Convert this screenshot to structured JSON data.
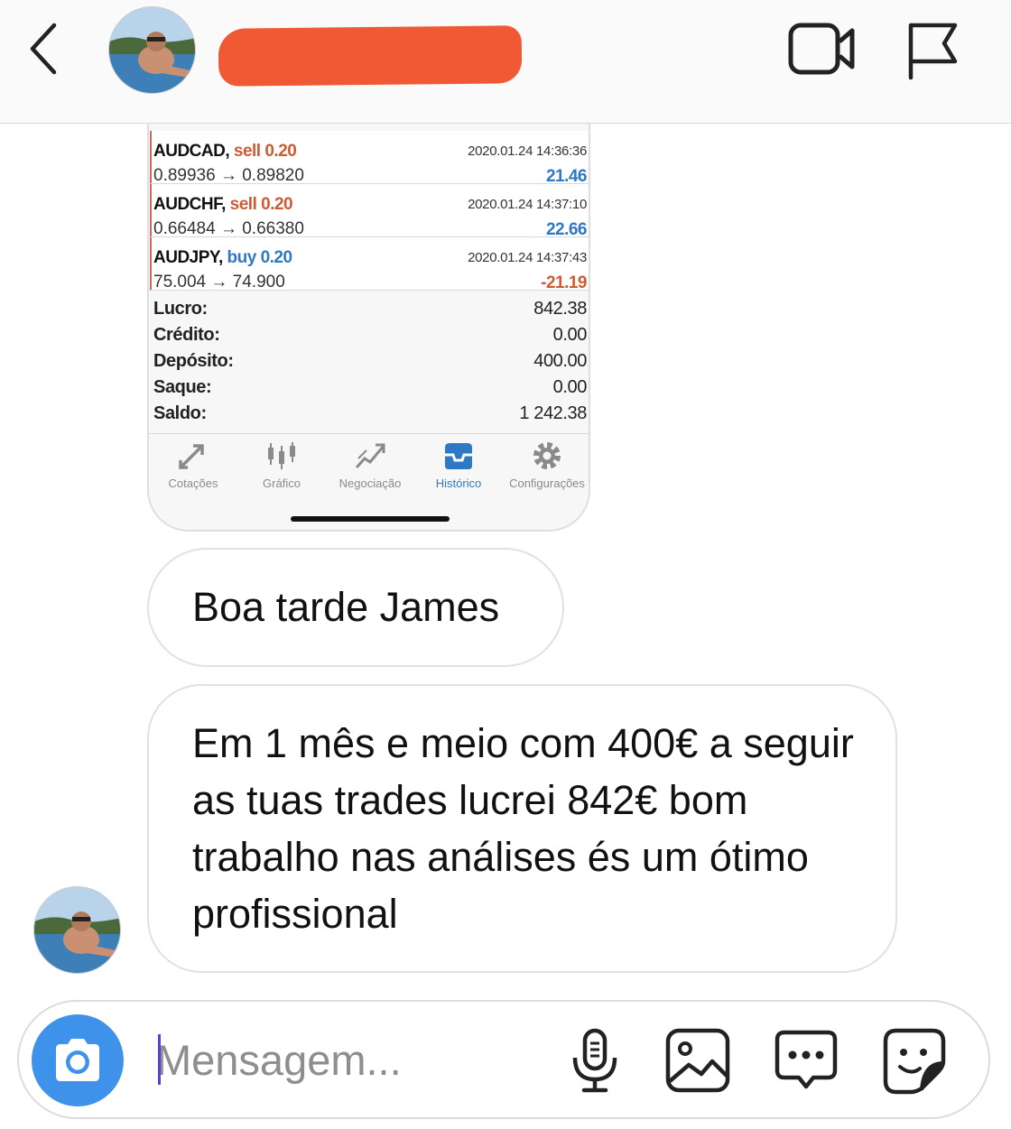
{
  "header": {
    "back_icon": "chevron-left-icon",
    "video_icon": "video-camera-icon",
    "flag_icon": "flag-icon",
    "redaction_color": "#ef5a35"
  },
  "screenshot": {
    "trades": [
      {
        "symbol": "AUDCAD,",
        "action": "sell 0.20",
        "action_type": "sell",
        "prices": "0.89936 → 0.89820",
        "time": "2020.01.24 14:36:36",
        "profit": "21.46",
        "profit_sign": "pos"
      },
      {
        "symbol": "AUDCHF,",
        "action": "sell 0.20",
        "action_type": "sell",
        "prices": "0.66484 → 0.66380",
        "time": "2020.01.24 14:37:10",
        "profit": "22.66",
        "profit_sign": "pos"
      },
      {
        "symbol": "AUDJPY,",
        "action": "buy 0.20",
        "action_type": "buy",
        "prices": "75.004 → 74.900",
        "time": "2020.01.24 14:37:43",
        "profit": "-21.19",
        "profit_sign": "neg"
      }
    ],
    "summary": [
      {
        "label": "Lucro:",
        "value": "842.38"
      },
      {
        "label": "Crédito:",
        "value": "0.00"
      },
      {
        "label": "Depósito:",
        "value": "400.00"
      },
      {
        "label": "Saque:",
        "value": "0.00"
      },
      {
        "label": "Saldo:",
        "value": "1 242.38"
      }
    ],
    "tabs": [
      {
        "label": "Cotações",
        "icon": "quotes-arrows-icon",
        "active": false
      },
      {
        "label": "Gráfico",
        "icon": "candlestick-chart-icon",
        "active": false
      },
      {
        "label": "Negociação",
        "icon": "trade-chart-icon",
        "active": false
      },
      {
        "label": "Histórico",
        "icon": "inbox-history-icon",
        "active": true
      },
      {
        "label": "Configurações",
        "icon": "gear-icon",
        "active": false
      }
    ],
    "colors": {
      "sell": "#cf5b34",
      "buy": "#2f78c4",
      "active_tab": "#2f78c4"
    }
  },
  "messages": [
    {
      "text": "Boa tarde James"
    },
    {
      "text": "Em 1 mês e meio com 400€ a seguir as tuas trades lucrei 842€ bom trabalho nas análises és um ótimo profissional"
    }
  ],
  "composer": {
    "placeholder": "Mensagem...",
    "camera_icon": "camera-icon",
    "mic_icon": "microphone-icon",
    "gallery_icon": "image-icon",
    "more_icon": "chat-dots-icon",
    "sticker_icon": "sticker-icon",
    "accent": "#3f92ea"
  }
}
